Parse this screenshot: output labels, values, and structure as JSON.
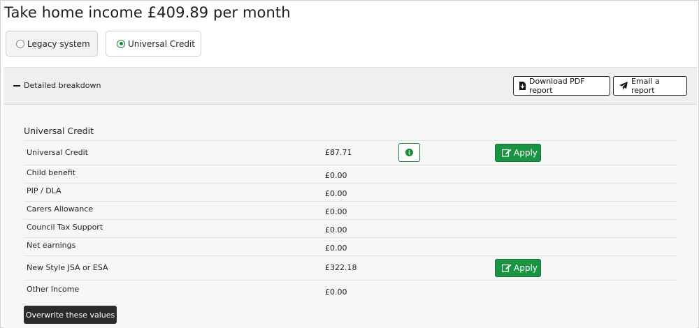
{
  "page_title": "Take home income £409.89 per month",
  "system_toggle": {
    "legacy_label": "Legacy system",
    "universal_label": "Universal Credit",
    "selected": "Universal Credit"
  },
  "panel": {
    "toggle_label": "Detailed breakdown",
    "download_pdf_label": "Download PDF report",
    "email_label": "Email a report"
  },
  "breakdown": {
    "section_title": "Universal Credit",
    "rows": [
      {
        "label": "Universal Credit",
        "amount": "£87.71",
        "apply": "Apply"
      },
      {
        "label": "Child benefit",
        "amount": "£0.00"
      },
      {
        "label": "PIP / DLA",
        "amount": "£0.00"
      },
      {
        "label": "Carers Allowance",
        "amount": "£0.00"
      },
      {
        "label": "Council Tax Support",
        "amount": "£0.00"
      },
      {
        "label": "Net earnings",
        "amount": "£0.00"
      },
      {
        "label": "New Style JSA or ESA",
        "amount": "£322.18",
        "apply": "Apply"
      },
      {
        "label": "Other Income",
        "amount": "£0.00"
      }
    ],
    "overwrite_label": "Overwrite these values"
  },
  "colors": {
    "accent_green": "#1a9343",
    "dark_button": "#2b2b2b"
  },
  "icons": [
    "file-pdf-icon",
    "paper-plane-icon",
    "info-icon",
    "edit-icon"
  ]
}
